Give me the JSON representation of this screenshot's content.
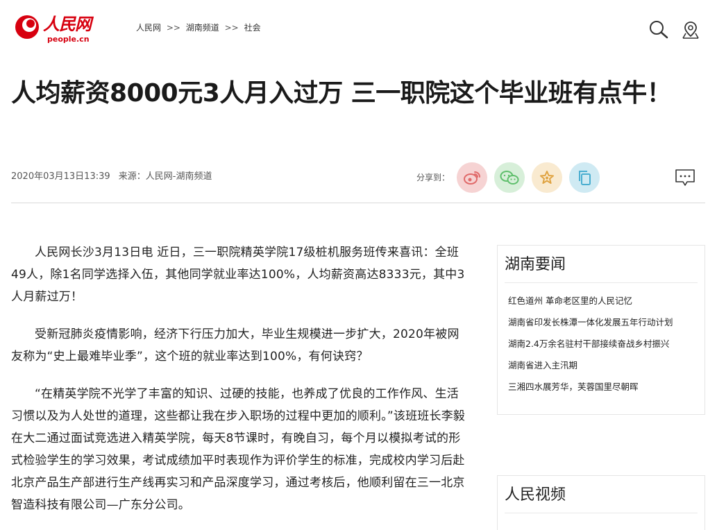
{
  "header": {
    "logo_cn": "人民网",
    "logo_en": "people.cn",
    "breadcrumb": [
      "人民网",
      "湖南频道",
      "社会"
    ],
    "breadcrumb_sep": ">>",
    "icons": [
      "search-icon",
      "location-icon"
    ]
  },
  "article": {
    "title": "人均薪资8000元3人月入过万 三一职院这个毕业班有点牛！",
    "date": "2020年03月13日13:39",
    "source_label": "来源：",
    "source": "人民网-湖南频道",
    "share_label": "分享到：",
    "share_buttons": [
      {
        "name": "weibo",
        "icon": "weibo-icon",
        "color": "#f6d3d3"
      },
      {
        "name": "wechat",
        "icon": "wechat-icon",
        "color": "#d7efd9"
      },
      {
        "name": "favorite",
        "icon": "star-icon",
        "color": "#f9ead0"
      },
      {
        "name": "copy",
        "icon": "copy-icon",
        "color": "#cfeaf3"
      }
    ],
    "paragraphs": [
      "人民网长沙3月13日电 近日，三一职院精英学院17级桩机服务班传来喜讯：全班49人，除1名同学选择入伍，其他同学就业率达100%，人均薪资高达8333元，其中3人月薪过万！",
      "受新冠肺炎疫情影响，经济下行压力加大，毕业生规模进一步扩大，2020年被网友称为“史上最难毕业季”，这个班的就业率达到100%，有何诀窍？",
      "“在精英学院不光学了丰富的知识、过硬的技能，也养成了优良的工作作风、生活习惯以及为人处世的道理，这些都让我在步入职场的过程中更加的顺利。”该班班长李毅在大二通过面试竞选进入精英学院，每天8节课时，有晚自习，每个月以模拟考试的形式检验学生的学习效果，考试成绩加平时表现作为评价学生的标准，完成校内学习后赴北京产品生产部进行生产线再实习和产品深度学习，通过考核后，他顺利留在三一北京智造科技有限公司—广东分公司。"
    ]
  },
  "sidebar": {
    "news_title": "湖南要闻",
    "news_items": [
      "红色道州 革命老区里的人民记忆",
      "湖南省印发长株潭一体化发展五年行动计划",
      "湖南2.4万余名驻村干部接续奋战乡村振兴",
      "湖南省进入主汛期",
      "三湘四水展芳华，芙蓉国里尽朝晖"
    ],
    "video_title": "人民视频"
  },
  "colors": {
    "brand_red": "#d7000f"
  }
}
